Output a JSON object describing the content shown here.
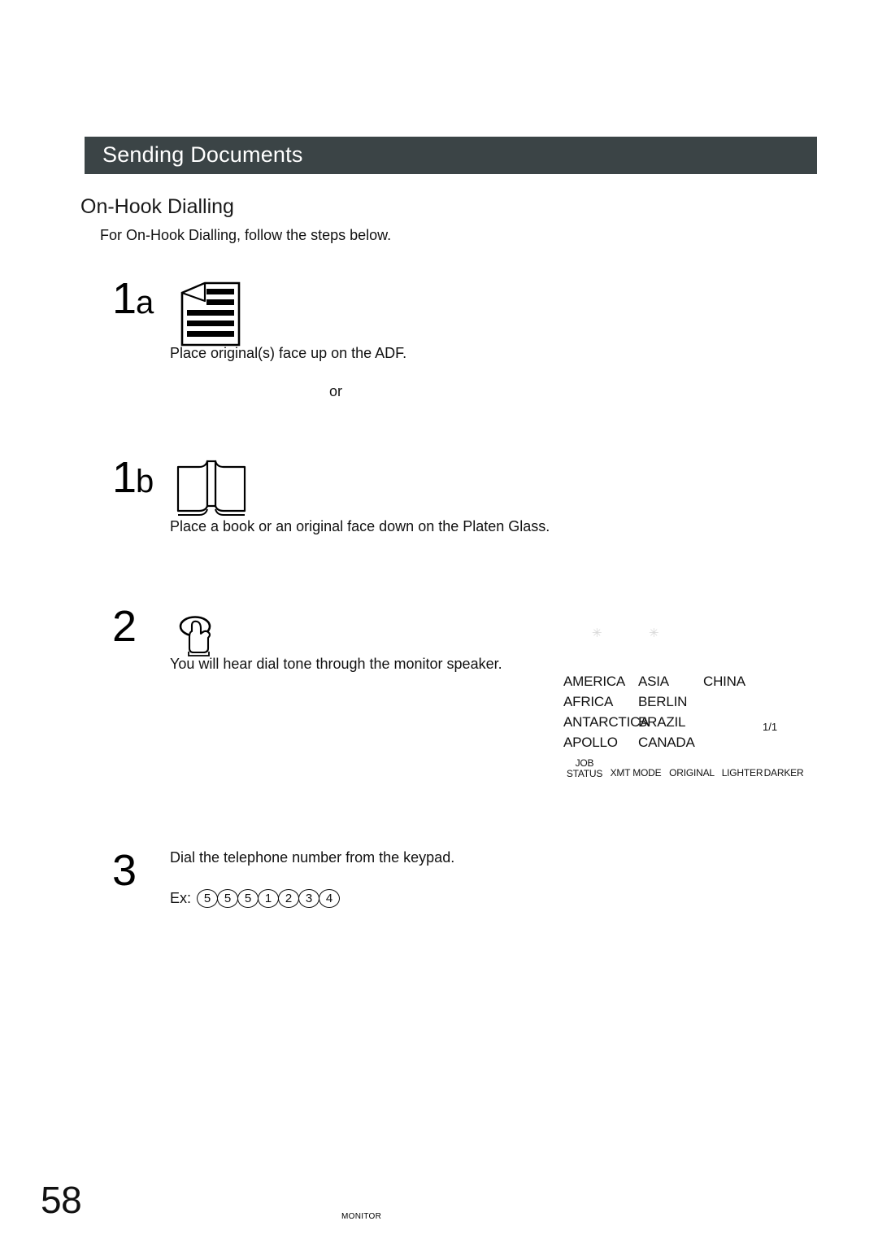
{
  "header": {
    "title": "Sending Documents"
  },
  "section": {
    "heading": "On-Hook Dialling",
    "intro": "For On-Hook Dialling, follow the steps below."
  },
  "steps": {
    "step1a": {
      "number": "1",
      "sublabel": "a",
      "icon": "document-face-up-icon",
      "caption": "Place original(s) face up on the ADF."
    },
    "divider": "or",
    "step1b": {
      "number": "1",
      "sublabel": "b",
      "icon": "open-book-icon",
      "caption": "Place a book or an original face down on the Platen Glass."
    },
    "step2": {
      "number": "2",
      "key_label": "MONITOR",
      "icon": "hand-press-button-icon",
      "caption": "You will hear dial tone through the monitor speaker."
    },
    "step3": {
      "number": "3",
      "caption": "Dial the telephone number from the keypad.",
      "example_label": "Ex:",
      "example_digits": [
        "5",
        "5",
        "5",
        "1",
        "2",
        "3",
        "4"
      ]
    }
  },
  "lcd": {
    "markers": [
      "✳",
      "✳"
    ],
    "rows": [
      [
        "AMERICA",
        "ASIA",
        "CHINA"
      ],
      [
        "AFRICA",
        "BERLIN",
        ""
      ],
      [
        "ANTARCTICA",
        "BRAZIL",
        ""
      ],
      [
        "APOLLO",
        "CANADA",
        ""
      ]
    ],
    "page_indicator": "1/1",
    "softkeys": [
      {
        "line1": "JOB",
        "line2": "STATUS"
      },
      {
        "line1": "XMT MODE",
        "line2": ""
      },
      {
        "line1": "ORIGINAL",
        "line2": ""
      },
      {
        "line1": "LIGHTER",
        "line2": ""
      },
      {
        "line1": "DARKER",
        "line2": ""
      }
    ]
  },
  "footer": {
    "page_number": "58"
  },
  "colors": {
    "header_bar": "#3b4446",
    "header_text": "#ffffff",
    "body_text": "#111111",
    "lcd_marker": "#d8d8d8"
  }
}
